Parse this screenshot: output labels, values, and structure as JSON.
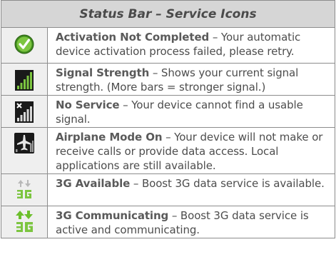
{
  "table": {
    "header": "Status Bar – Service Icons",
    "rows": [
      {
        "icon": "activation-check-icon",
        "term": "Activation Not Completed",
        "desc": " – Your automatic device activation process failed, please retry."
      },
      {
        "icon": "signal-strength-icon",
        "term": "Signal Strength",
        "desc": " – Shows your current signal strength. (More bars = stronger signal.)"
      },
      {
        "icon": "no-service-icon",
        "term": "No Service",
        "desc": " – Your device cannot find a usable signal."
      },
      {
        "icon": "airplane-mode-icon",
        "term": "Airplane Mode On",
        "desc": " – Your device will not make or receive calls or provide data access. Local applications are still available."
      },
      {
        "icon": "3g-available-icon",
        "term": "3G Available",
        "desc": " – Boost 3G data service is available."
      },
      {
        "icon": "3g-communicating-icon",
        "term": "3G Communicating",
        "desc": " – Boost 3G data service is active and communicating."
      }
    ]
  },
  "colors": {
    "header_bg": "#d6d6d6",
    "icon_cell_bg": "#efefef",
    "green": "#5fb830",
    "text": "#4d4d4d"
  }
}
